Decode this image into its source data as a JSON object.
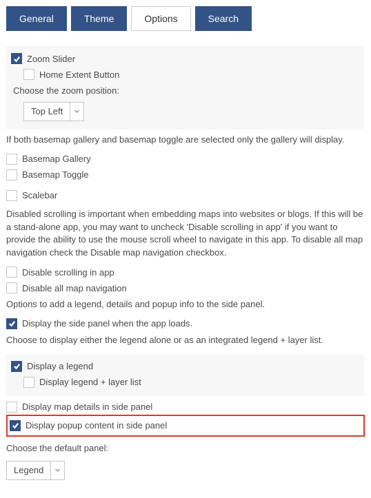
{
  "tabs": {
    "general": "General",
    "theme": "Theme",
    "options": "Options",
    "search": "Search"
  },
  "zoom": {
    "slider_label": "Zoom Slider",
    "home_extent_label": "Home Extent Button",
    "position_label": "Choose the zoom position:",
    "position_value": "Top Left"
  },
  "basemap": {
    "info": "If both basemap gallery and basemap toggle are selected only the gallery will display.",
    "gallery_label": "Basemap Gallery",
    "toggle_label": "Basemap Toggle"
  },
  "scalebar_label": "Scalebar",
  "scroll": {
    "info": "Disabled scrolling is important when embedding maps into websites or blogs. If this will be a stand-alone app, you may want to uncheck 'Disable scrolling in app' if you want to provide the ability to use the mouse scroll wheel to navigate in this app. To disable all map navigation check the Disable map navigation checkbox.",
    "disable_scroll_label": "Disable scrolling in app",
    "disable_nav_label": "Disable all map navigation"
  },
  "panel": {
    "options_text": "Options to add a legend, details and popup info to the side panel.",
    "display_on_load_label": "Display the side panel when the app loads.",
    "choose_text": "Choose to display either the legend alone or as an integrated legend + layer list.",
    "legend_label": "Display a legend",
    "legend_layer_label": "Display legend + layer list",
    "map_details_label": "Display map details in side panel",
    "popup_label": "Display popup content in side panel",
    "default_label": "Choose the default panel:",
    "default_value": "Legend"
  }
}
